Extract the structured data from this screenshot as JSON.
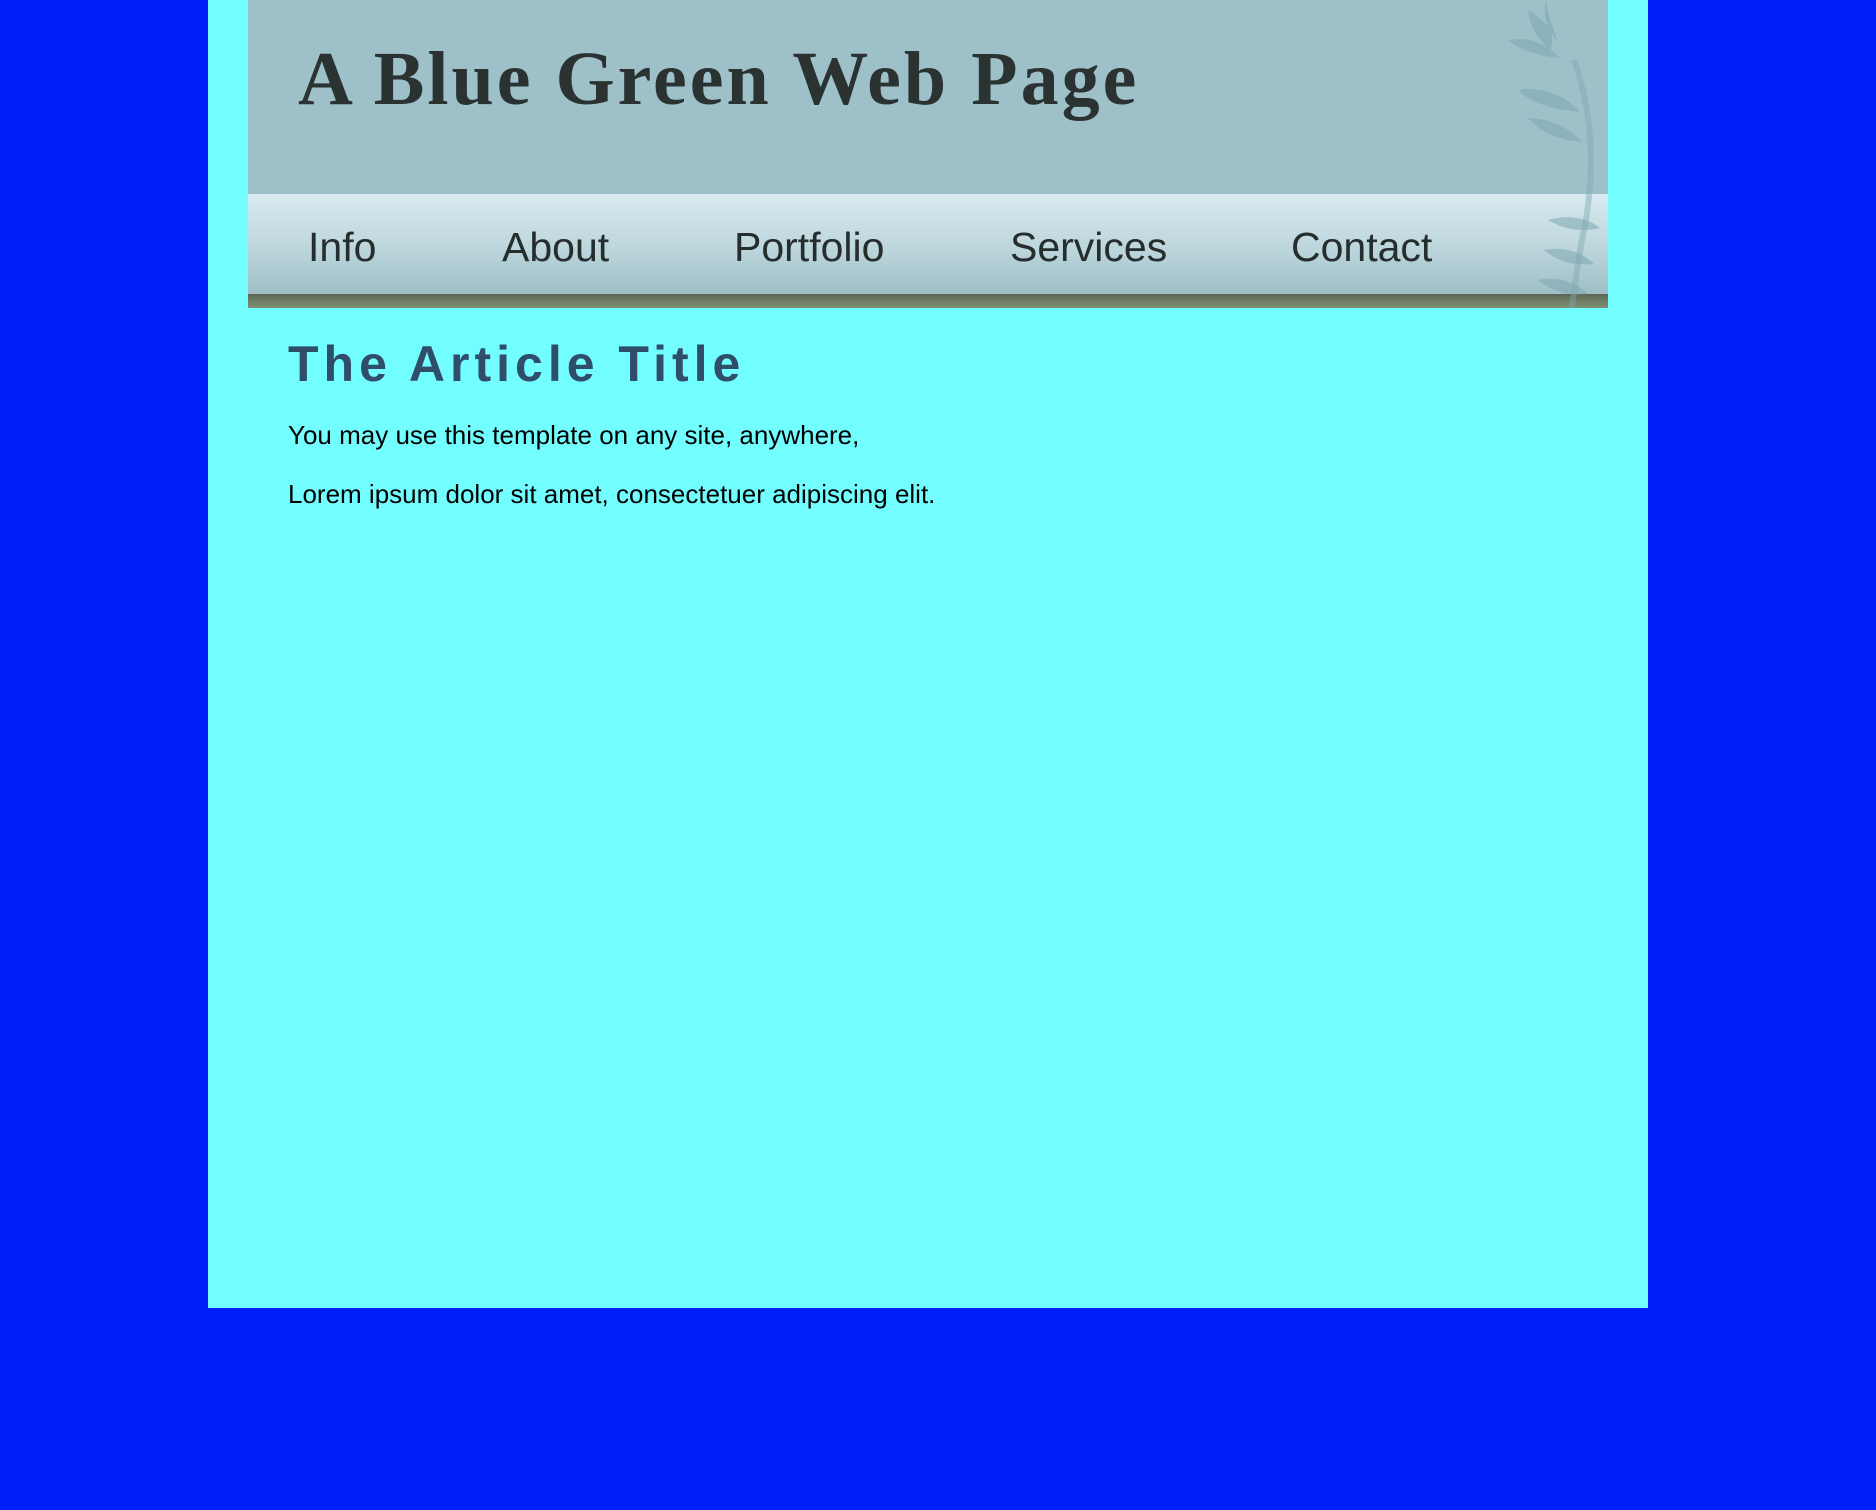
{
  "header": {
    "title": "A Blue Green Web Page"
  },
  "nav": {
    "items": [
      {
        "label": "Info"
      },
      {
        "label": "About"
      },
      {
        "label": "Portfolio"
      },
      {
        "label": "Services"
      },
      {
        "label": "Contact"
      }
    ]
  },
  "article": {
    "title": "The Article Title",
    "paragraphs": [
      "You may use this template on any site, anywhere,",
      "Lorem ipsum dolor sit amet, consectetuer adipiscing elit."
    ]
  },
  "colors": {
    "page_background": "#001efa",
    "content_background": "#72feff",
    "header_background": "#9ec1c9",
    "title_text": "#2b3232",
    "article_title_text": "#304d6a",
    "nav_text": "#252d2d"
  },
  "icons": {
    "decoration": "bamboo-leaves-icon"
  }
}
